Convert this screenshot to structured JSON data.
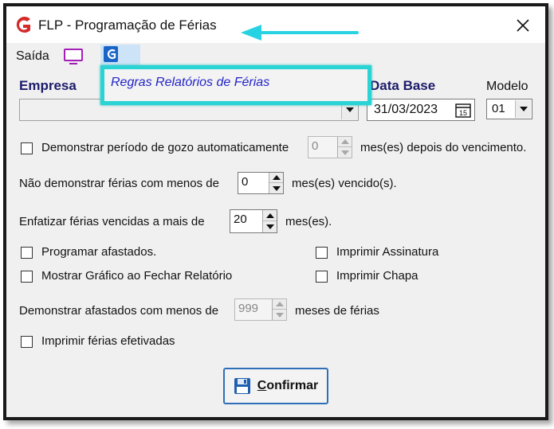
{
  "window": {
    "title": "FLP - Programação de Férias",
    "close_label": "✕"
  },
  "menu": {
    "saida_label": "Saída",
    "dropdown_item": "Regras Relatórios de Férias"
  },
  "form": {
    "empresa_label": "Empresa",
    "empresa_value": "",
    "data_base_label": "Data Base",
    "data_base_value": "31/03/2023",
    "modelo_label": "Modelo",
    "modelo_value": "01",
    "demonstrar_periodo_label": "Demonstrar período de gozo automaticamente",
    "demonstrar_periodo_value": "0",
    "demonstrar_periodo_suffix": "mes(es) depois do vencimento.",
    "nao_demonstrar_label": "Não demonstrar férias com menos de",
    "nao_demonstrar_value": "0",
    "nao_demonstrar_suffix": "mes(es) vencido(s).",
    "enfatizar_label": "Enfatizar férias vencidas a  mais  de",
    "enfatizar_value": "20",
    "enfatizar_suffix": "mes(es).",
    "programar_afastados_label": "Programar afastados.",
    "imprimir_assinatura_label": "Imprimir Assinatura",
    "mostrar_grafico_label": "Mostrar Gráfico ao Fechar Relatório",
    "imprimir_chapa_label": "Imprimir Chapa",
    "afastados_label": "Demonstrar afastados com menos de",
    "afastados_value": "999",
    "afastados_suffix": "meses de férias",
    "imprimir_efetivadas_label": "Imprimir férias efetivadas",
    "confirm_underlined": "C",
    "confirm_rest": "onfirmar"
  },
  "colors": {
    "highlight_border": "#2ad4d4",
    "arrow": "#27d3e3",
    "menu_link": "#2323c8",
    "label_bold": "#1c1c6a",
    "logo_red": "#d42a2a"
  },
  "icons": {
    "app_logo": "g-logo-icon",
    "tv": "monitor-icon",
    "g_menu": "g-menu-icon",
    "calendar": "calendar-icon",
    "disk": "floppy-disk-icon",
    "close": "close-icon"
  }
}
